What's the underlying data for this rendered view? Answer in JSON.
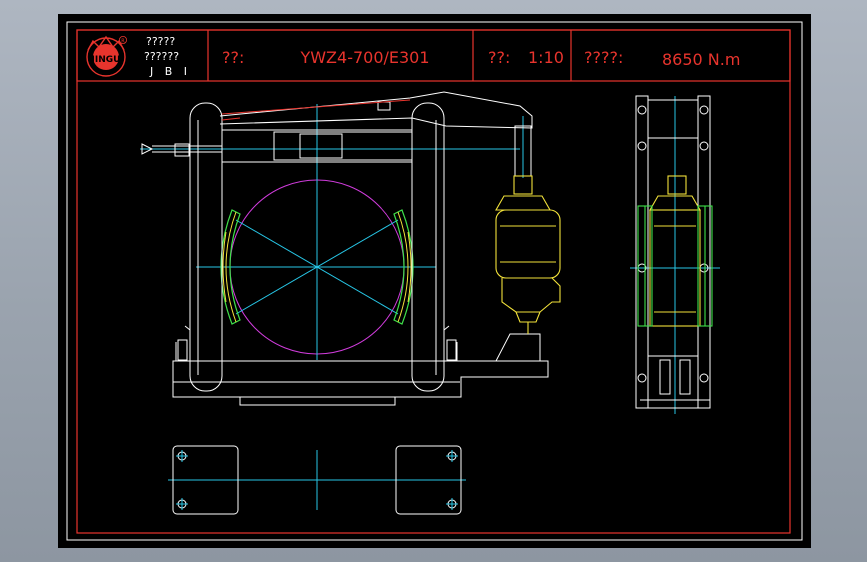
{
  "title_block": {
    "company_line1": "?????",
    "company_line2": "??????",
    "company_line3": "J B I",
    "logo_text": "JINGU",
    "name_label": "??:",
    "model_value": "YWZ4-700/E301",
    "scale_label": "??:",
    "scale_value": "1:10",
    "torque_label": "????:",
    "torque_value": "8650 N.m"
  },
  "colors": {
    "frame": "#e8342d",
    "outline": "#ffffff",
    "centerline": "#27c6e6",
    "circle": "#d03cdc",
    "thruster": "#f2e23a",
    "shoe": "#3fe04a"
  }
}
